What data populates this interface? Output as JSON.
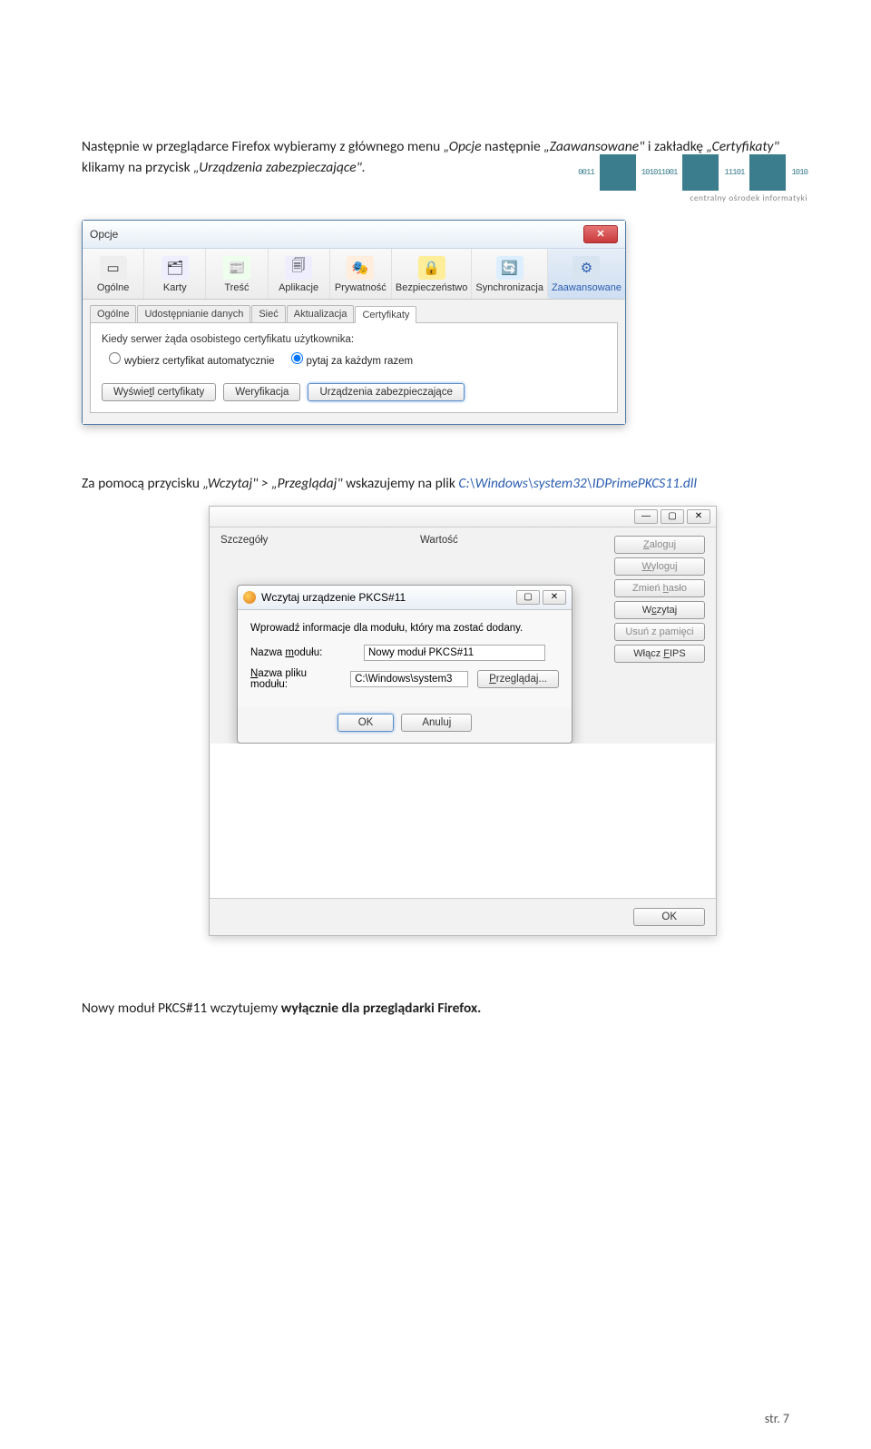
{
  "logo": {
    "binary_text": "0011 101011001 10101 11101 1010",
    "subtitle": "centralny ośrodek informatyki"
  },
  "para1": {
    "pre": "Następnie w przeglądarce Firefox wybieramy z głównego menu ",
    "opcje": "„Opcje",
    "mid1": " następnie ",
    "zaaw": "„Zaawansowane\"",
    "mid2": " i zakładkę ",
    "cert": "„Certyfikaty\"",
    "mid3": " klikamy na przycisk ",
    "urz": "„Urządzenia zabezpieczające\".",
    "post_quotes": ""
  },
  "dlg1": {
    "title": "Opcje",
    "icons": [
      "Ogólne",
      "Karty",
      "Treść",
      "Aplikacje",
      "Prywatność",
      "Bezpieczeństwo",
      "Synchronizacja",
      "Zaawansowane"
    ],
    "icon_glyphs": [
      "▭",
      "🗂",
      "📰",
      "🗐",
      "🎭",
      "🔒",
      "🔄",
      "⚙"
    ],
    "mini_tabs": [
      "Ogólne",
      "Udostępnianie danych",
      "Sieć",
      "Aktualizacja",
      "Certyfikaty"
    ],
    "cert_label": "Kiedy serwer żąda osobistego certyfikatu użytkownika:",
    "radio1": "wybierz certyfikat automatycznie",
    "radio2": "pytaj za każdym razem",
    "btn1": "Wyświetl certyfikaty",
    "btn2": "Weryfikacja",
    "btn3": "Urządzenia zabezpieczające"
  },
  "para2": {
    "pre": "Za pomocą przycisku ",
    "wcz": "„Wczytaj\" > „Przeglądaj\"",
    "mid": " wskazujemy na plik ",
    "path": "C:\\Windows\\system32\\IDPrimePKCS11.dll"
  },
  "dlg2": {
    "col1": "Szczegóły",
    "col2": "Wartość",
    "side": [
      "Zaloguj",
      "Wyloguj",
      "Zmień hasło",
      "Wczytaj",
      "Usuń z pamięci",
      "Włącz FIPS"
    ],
    "inner_title": "Wczytaj urządzenie PKCS#11",
    "desc": "Wprowadź informacje dla modułu, który ma zostać dodany.",
    "name_label": "Nazwa modułu:",
    "name_val": "Nowy moduł PKCS#11",
    "file_label": "Nazwa pliku modułu:",
    "file_val": "C:\\Windows\\system3",
    "browse": "Przeglądaj...",
    "ok": "OK",
    "cancel": "Anuluj",
    "bottom_ok": "OK"
  },
  "final": {
    "pre": "Nowy moduł PKCS#11 wczytujemy ",
    "bold": "wyłącznie dla przeglądarki Firefox."
  },
  "page": "str. 7"
}
